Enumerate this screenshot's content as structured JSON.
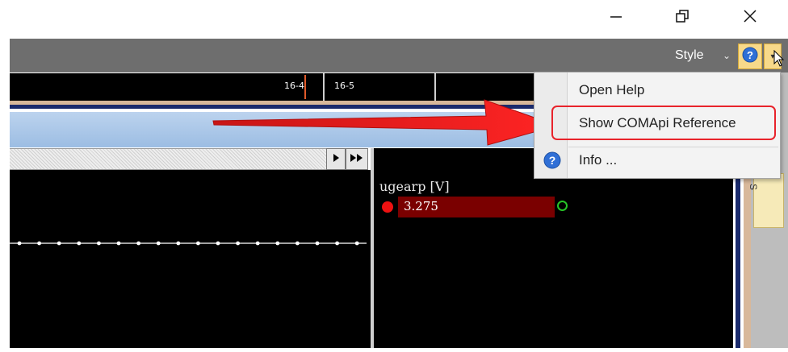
{
  "window": {
    "minimize_icon": "minimize-icon",
    "restore_icon": "restore-icon",
    "close_icon": "close-icon"
  },
  "ribbon": {
    "style_label": "Style",
    "style_dropdown_icon": "chevron-down-icon",
    "help_icon": "help-question-icon",
    "help_dropdown_icon": "chevron-down-icon"
  },
  "timeline": {
    "labels": [
      "16-4",
      "16-5"
    ]
  },
  "menu": {
    "items": [
      {
        "label": "Open Help"
      },
      {
        "label": "Show COMApi Reference",
        "highlighted": true
      },
      {
        "label": "Info ...",
        "icon": "info-question-icon"
      }
    ]
  },
  "signal": {
    "name": "ugearp [V]",
    "value": "3.275",
    "dot_color": "#ee1111",
    "ring_color": "#27c427"
  },
  "side_tab": {
    "label": "S"
  },
  "colors": {
    "annotation_red": "#e8232b",
    "ribbon_grey": "#6e6e6e",
    "plot_bg": "#000000"
  }
}
